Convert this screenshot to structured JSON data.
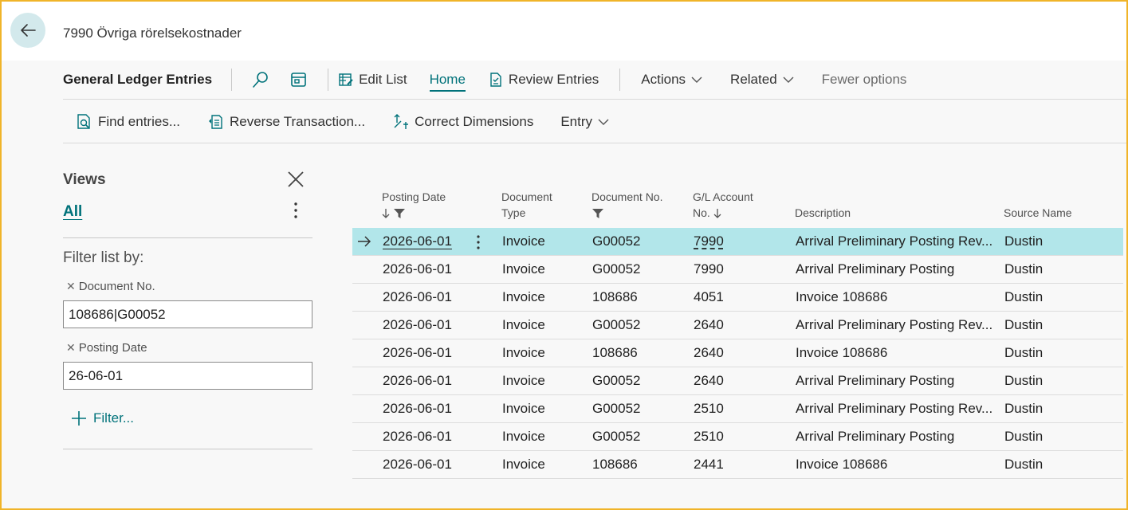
{
  "header": {
    "title": "7990 Övriga rörelsekostnader"
  },
  "actionbar": {
    "page_name": "General Ledger Entries",
    "edit_list": "Edit List",
    "home": "Home",
    "review_entries": "Review Entries",
    "actions": "Actions",
    "related": "Related",
    "fewer_options": "Fewer options"
  },
  "subbar": {
    "find_entries": "Find entries...",
    "reverse_transaction": "Reverse Transaction...",
    "correct_dimensions": "Correct Dimensions",
    "entry": "Entry"
  },
  "views": {
    "title": "Views",
    "all": "All",
    "filter_list_by": "Filter list by:",
    "filters": [
      {
        "name": "Document No.",
        "value": "108686|G00052"
      },
      {
        "name": "Posting Date",
        "value": "26-06-01"
      }
    ],
    "add_filter": "Filter..."
  },
  "grid": {
    "columns": {
      "posting_date": "Posting Date",
      "document_type_1": "Document",
      "document_type_2": "Type",
      "document_no": "Document No.",
      "gl_account_1": "G/L Account",
      "gl_account_2": "No.",
      "description": "Description",
      "source_name": "Source Name"
    },
    "rows": [
      {
        "posting_date": "2026-06-01",
        "document_type": "Invoice",
        "document_no": "G00052",
        "gl_account": "7990",
        "description": "Arrival Preliminary Posting Rev...",
        "source_name": "Dustin"
      },
      {
        "posting_date": "2026-06-01",
        "document_type": "Invoice",
        "document_no": "G00052",
        "gl_account": "7990",
        "description": "Arrival Preliminary Posting",
        "source_name": "Dustin"
      },
      {
        "posting_date": "2026-06-01",
        "document_type": "Invoice",
        "document_no": "108686",
        "gl_account": "4051",
        "description": "Invoice 108686",
        "source_name": "Dustin"
      },
      {
        "posting_date": "2026-06-01",
        "document_type": "Invoice",
        "document_no": "G00052",
        "gl_account": "2640",
        "description": "Arrival Preliminary Posting Rev...",
        "source_name": "Dustin"
      },
      {
        "posting_date": "2026-06-01",
        "document_type": "Invoice",
        "document_no": "108686",
        "gl_account": "2640",
        "description": "Invoice 108686",
        "source_name": "Dustin"
      },
      {
        "posting_date": "2026-06-01",
        "document_type": "Invoice",
        "document_no": "G00052",
        "gl_account": "2640",
        "description": "Arrival Preliminary Posting",
        "source_name": "Dustin"
      },
      {
        "posting_date": "2026-06-01",
        "document_type": "Invoice",
        "document_no": "G00052",
        "gl_account": "2510",
        "description": "Arrival Preliminary Posting Rev...",
        "source_name": "Dustin"
      },
      {
        "posting_date": "2026-06-01",
        "document_type": "Invoice",
        "document_no": "G00052",
        "gl_account": "2510",
        "description": "Arrival Preliminary Posting",
        "source_name": "Dustin"
      },
      {
        "posting_date": "2026-06-01",
        "document_type": "Invoice",
        "document_no": "108686",
        "gl_account": "2441",
        "description": "Invoice 108686",
        "source_name": "Dustin"
      }
    ]
  },
  "colors": {
    "accent": "#00727a",
    "selected_row": "#b2e6ea",
    "frame_border": "#f0b429"
  }
}
